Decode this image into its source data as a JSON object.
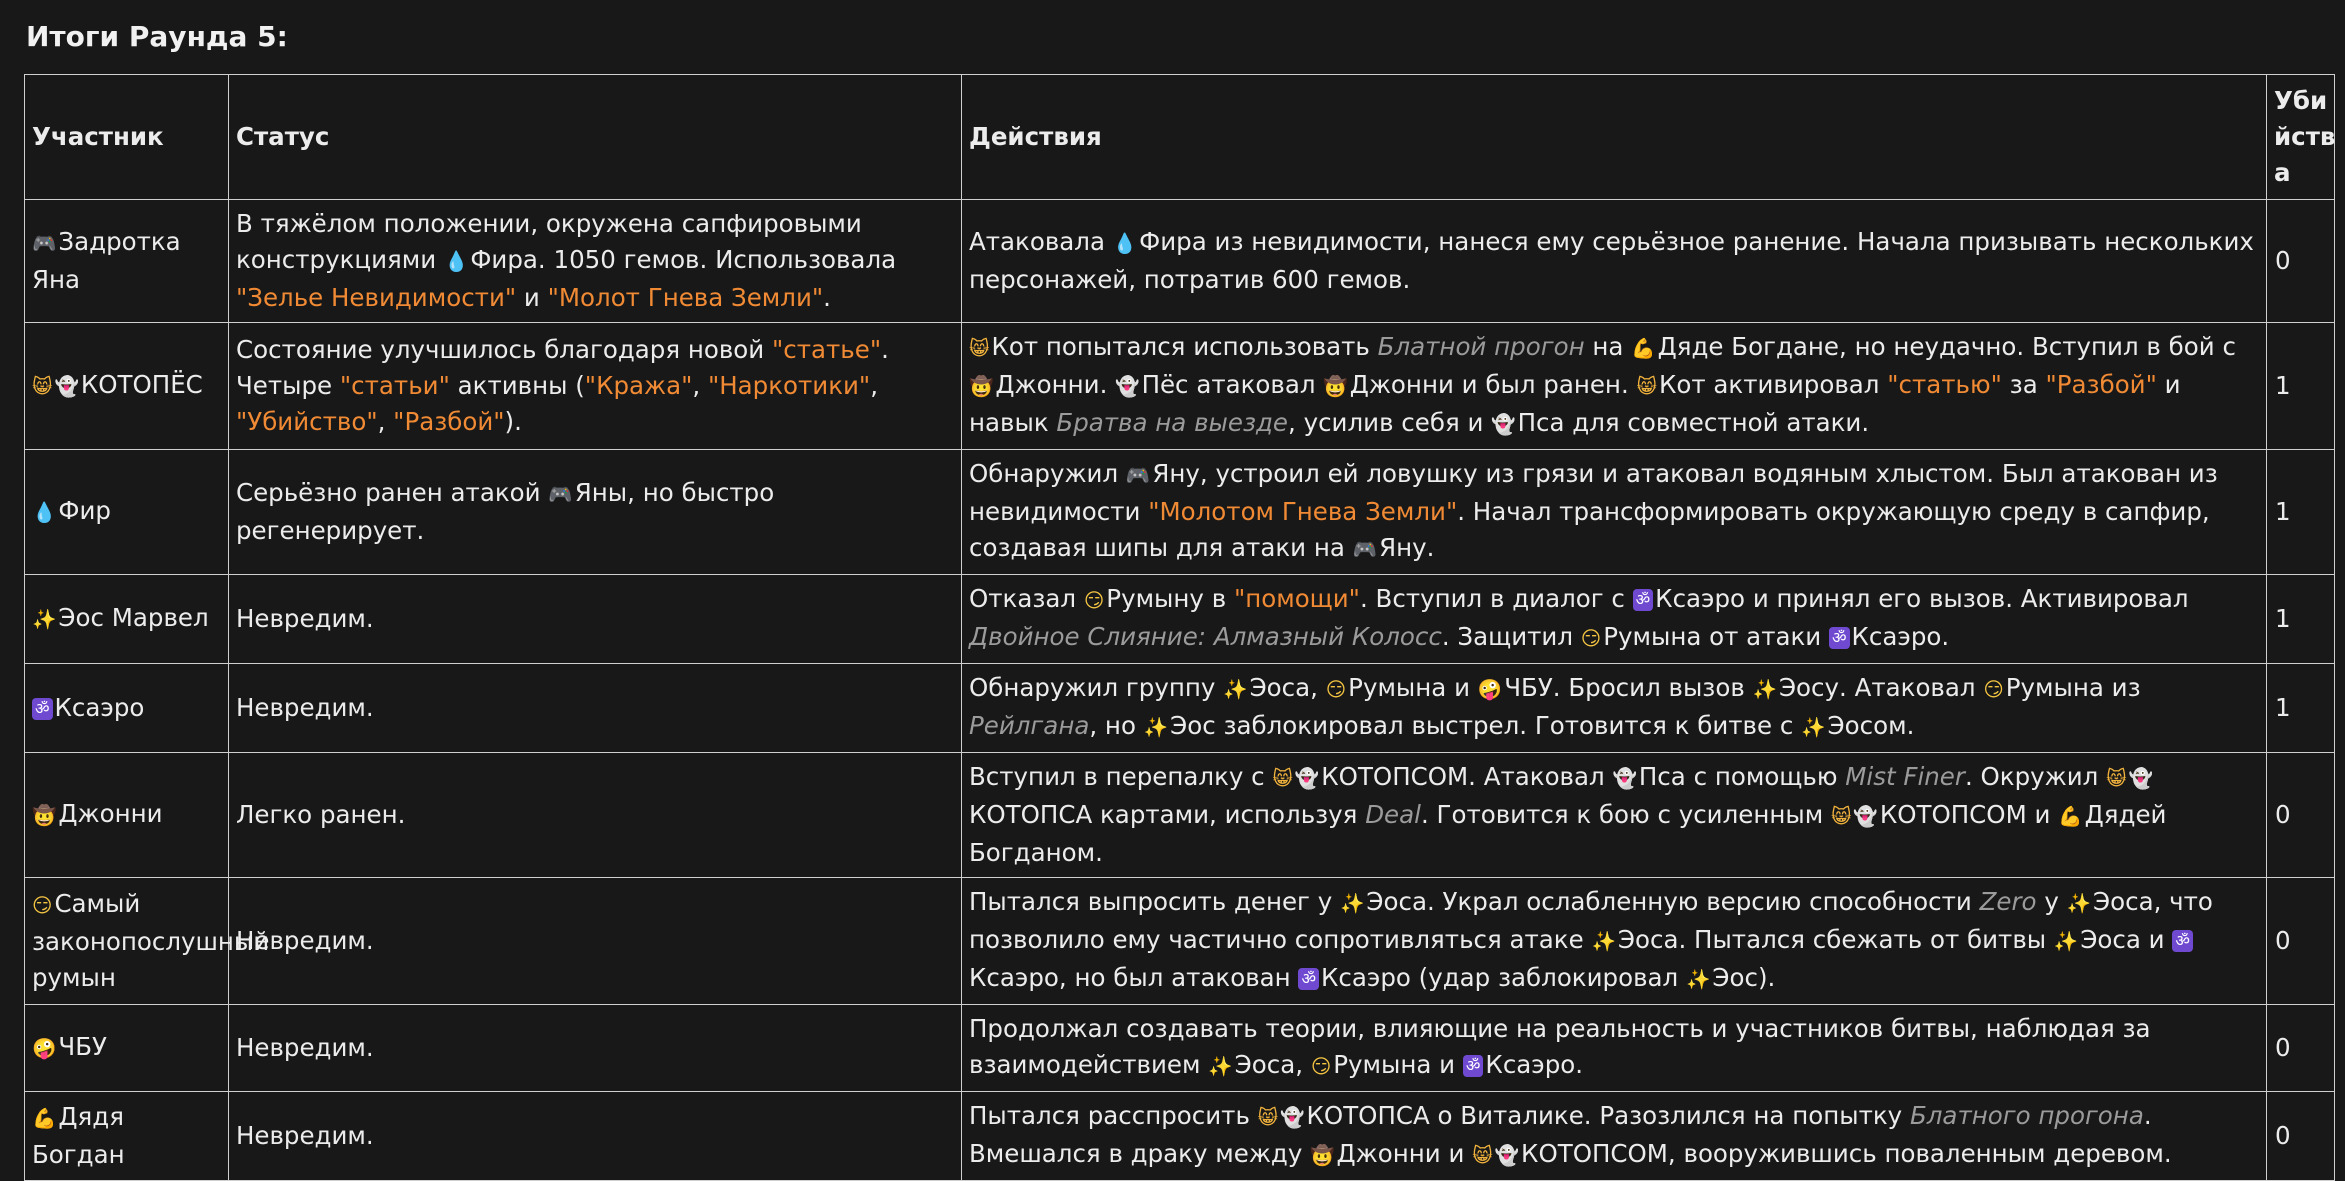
{
  "title": "Итоги Раунда 5:",
  "headers": {
    "participant": "Участник",
    "status": "Статус",
    "actions": "Действия",
    "kills": "Убийства"
  },
  "rows": [
    {
      "participant": [
        {
          "icon": "gamepad",
          "t": "Задротка Яна"
        }
      ],
      "status": [
        {
          "t": "В тяжёлом положении, окружена сапфировыми конструкциями "
        },
        {
          "icon": "droplet",
          "t": "Фира. 1050 гемов. Использовала "
        },
        {
          "t": "\"Зелье Невидимости\"",
          "s": "hl"
        },
        {
          "t": " и "
        },
        {
          "t": "\"Молот Гнева Земли\"",
          "s": "hl"
        },
        {
          "t": "."
        }
      ],
      "actions": [
        {
          "t": "Атаковала "
        },
        {
          "icon": "droplet",
          "t": "Фира из невидимости, нанеся ему серьёзное ранение. Начала призывать нескольких персонажей, потратив 600 гемов."
        }
      ],
      "kills": "0"
    },
    {
      "participant": [
        {
          "icon": "cat",
          "t": ""
        },
        {
          "icon": "ghost",
          "t": "КОТОПЁС"
        }
      ],
      "status": [
        {
          "t": "Состояние улучшилось благодаря новой "
        },
        {
          "t": "\"статье\"",
          "s": "hl"
        },
        {
          "t": ". Четыре "
        },
        {
          "t": "\"статьи\"",
          "s": "hl"
        },
        {
          "t": " активны ("
        },
        {
          "t": "\"Кража\"",
          "s": "hl"
        },
        {
          "t": ", "
        },
        {
          "t": "\"Наркотики\"",
          "s": "hl"
        },
        {
          "t": ", "
        },
        {
          "t": "\"Убийство\"",
          "s": "hl"
        },
        {
          "t": ", "
        },
        {
          "t": "\"Разбой\"",
          "s": "hl"
        },
        {
          "t": ")."
        }
      ],
      "actions": [
        {
          "icon": "cat",
          "t": "Кот попытался использовать "
        },
        {
          "t": "Блатной прогон",
          "s": "it"
        },
        {
          "t": " на "
        },
        {
          "icon": "muscle",
          "t": "Дяде Богдане, но неудачно. Вступил в бой с "
        },
        {
          "icon": "cowboy",
          "t": "Джонни. "
        },
        {
          "icon": "ghost",
          "t": "Пёс атаковал "
        },
        {
          "icon": "cowboy",
          "t": "Джонни и был ранен. "
        },
        {
          "icon": "cat",
          "t": "Кот активировал "
        },
        {
          "t": "\"статью\"",
          "s": "hl"
        },
        {
          "t": " за "
        },
        {
          "t": "\"Разбой\"",
          "s": "hl"
        },
        {
          "t": " и навык "
        },
        {
          "t": "Братва на выезде",
          "s": "it"
        },
        {
          "t": ", усилив себя и "
        },
        {
          "icon": "ghost",
          "t": "Пса для совместной атаки."
        }
      ],
      "kills": "1"
    },
    {
      "participant": [
        {
          "icon": "droplet",
          "t": "Фир"
        }
      ],
      "status": [
        {
          "t": "Серьёзно ранен атакой "
        },
        {
          "icon": "gamepad",
          "t": "Яны, но быстро регенерирует."
        }
      ],
      "actions": [
        {
          "t": "Обнаружил "
        },
        {
          "icon": "gamepad",
          "t": "Яну, устроил ей ловушку из грязи и атаковал водяным хлыстом. Был атакован из невидимости "
        },
        {
          "t": "\"Молотом Гнева Земли\"",
          "s": "hl"
        },
        {
          "t": ". Начал трансформировать окружающую среду в сапфир, создавая шипы для атаки на "
        },
        {
          "icon": "gamepad",
          "t": "Яну."
        }
      ],
      "kills": "1"
    },
    {
      "participant": [
        {
          "icon": "sparkles",
          "t": "Эос Марвел"
        }
      ],
      "status": [
        {
          "t": "Невредим."
        }
      ],
      "actions": [
        {
          "t": "Отказал "
        },
        {
          "icon": "smirk",
          "t": "Румыну в "
        },
        {
          "t": "\"помощи\"",
          "s": "hl"
        },
        {
          "t": ". Вступил в диалог с "
        },
        {
          "icon": "om",
          "t": "Ксаэро и принял его вызов. Активировал "
        },
        {
          "t": "Двойное Слияние: Алмазный Колосс",
          "s": "it"
        },
        {
          "t": ". Защитил "
        },
        {
          "icon": "smirk",
          "t": "Румына от атаки "
        },
        {
          "icon": "om",
          "t": "Ксаэро."
        }
      ],
      "kills": "1"
    },
    {
      "participant": [
        {
          "icon": "om",
          "t": "Ксаэро"
        }
      ],
      "status": [
        {
          "t": "Невредим."
        }
      ],
      "actions": [
        {
          "t": "Обнаружил группу "
        },
        {
          "icon": "sparkles",
          "t": "Эоса, "
        },
        {
          "icon": "smirk",
          "t": "Румына и "
        },
        {
          "icon": "zany",
          "t": "ЧБУ. Бросил вызов "
        },
        {
          "icon": "sparkles",
          "t": "Эосу. Атаковал "
        },
        {
          "icon": "smirk",
          "t": "Румына из "
        },
        {
          "t": "Рейлгана",
          "s": "it"
        },
        {
          "t": ", но "
        },
        {
          "icon": "sparkles",
          "t": "Эос заблокировал выстрел. Готовится к битве с "
        },
        {
          "icon": "sparkles",
          "t": "Эосом."
        }
      ],
      "kills": "1"
    },
    {
      "participant": [
        {
          "icon": "cowboy",
          "t": "Джонни"
        }
      ],
      "status": [
        {
          "t": "Легко ранен."
        }
      ],
      "actions": [
        {
          "t": "Вступил в перепалку с "
        },
        {
          "icon": "cat",
          "t": ""
        },
        {
          "icon": "ghost",
          "t": "КОТОПСОМ. Атаковал "
        },
        {
          "icon": "ghost",
          "t": "Пса с помощью "
        },
        {
          "t": "Mist Finer",
          "s": "it"
        },
        {
          "t": ". Окружил "
        },
        {
          "icon": "cat",
          "t": ""
        },
        {
          "icon": "ghost",
          "t": "КОТОПСА картами, используя "
        },
        {
          "t": "Deal",
          "s": "it"
        },
        {
          "t": ". Готовится к бою с усиленным "
        },
        {
          "icon": "cat",
          "t": ""
        },
        {
          "icon": "ghost",
          "t": "КОТОПСОМ и "
        },
        {
          "icon": "muscle",
          "t": "Дядей Богданом."
        }
      ],
      "kills": "0"
    },
    {
      "participant": [
        {
          "icon": "smirk",
          "t": "Самый законопослушный румын"
        }
      ],
      "status": [
        {
          "t": "Невредим."
        }
      ],
      "actions": [
        {
          "t": "Пытался выпросить денег у "
        },
        {
          "icon": "sparkles",
          "t": "Эоса. Украл ослабленную версию способности "
        },
        {
          "t": "Zero",
          "s": "it"
        },
        {
          "t": " у "
        },
        {
          "icon": "sparkles",
          "t": "Эоса, что позволило ему частично сопротивляться атаке "
        },
        {
          "icon": "sparkles",
          "t": "Эоса. Пытался сбежать от битвы "
        },
        {
          "icon": "sparkles",
          "t": "Эоса и "
        },
        {
          "icon": "om",
          "t": "Ксаэро, но был атакован "
        },
        {
          "icon": "om",
          "t": "Ксаэро (удар заблокировал "
        },
        {
          "icon": "sparkles",
          "t": "Эос)."
        }
      ],
      "kills": "0"
    },
    {
      "participant": [
        {
          "icon": "zany",
          "t": "ЧБУ"
        }
      ],
      "status": [
        {
          "t": "Невредим."
        }
      ],
      "actions": [
        {
          "t": "Продолжал создавать теории, влияющие на реальность и участников битвы, наблюдая за взаимодействием "
        },
        {
          "icon": "sparkles",
          "t": "Эоса, "
        },
        {
          "icon": "smirk",
          "t": "Румына и "
        },
        {
          "icon": "om",
          "t": "Ксаэро."
        }
      ],
      "kills": "0"
    },
    {
      "participant": [
        {
          "icon": "muscle",
          "t": "Дядя Богдан"
        }
      ],
      "status": [
        {
          "t": "Невредим."
        }
      ],
      "actions": [
        {
          "t": "Пытался расспросить "
        },
        {
          "icon": "cat",
          "t": ""
        },
        {
          "icon": "ghost",
          "t": "КОТОПСА о Виталике. Разозлился на попытку "
        },
        {
          "t": "Блатного прогона",
          "s": "it"
        },
        {
          "t": ". Вмешался в драку между "
        },
        {
          "icon": "cowboy",
          "t": "Джонни и "
        },
        {
          "icon": "cat",
          "t": ""
        },
        {
          "icon": "ghost",
          "t": "КОТОПСОМ, вооружившись поваленным деревом."
        }
      ],
      "kills": "0"
    }
  ]
}
